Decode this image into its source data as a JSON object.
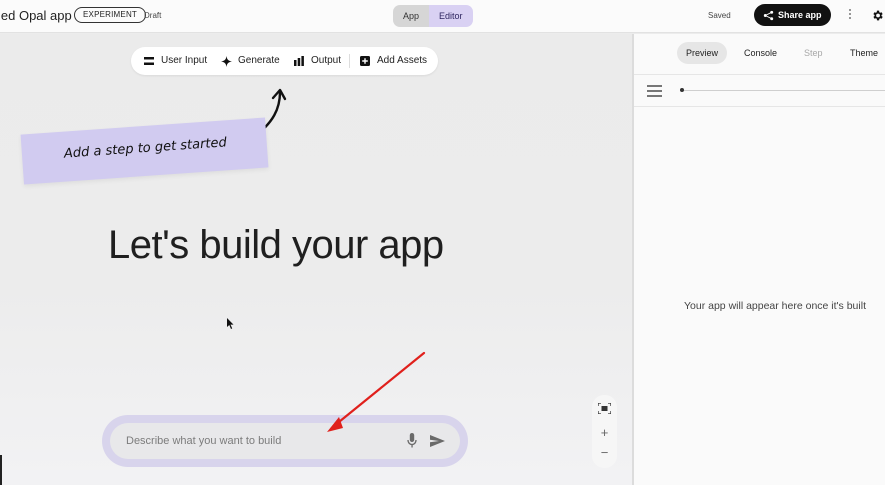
{
  "header": {
    "title": "led Opal app",
    "badge": "EXPERIMENT",
    "status": "Draft",
    "tabs": [
      {
        "label": "App",
        "active": false
      },
      {
        "label": "Editor",
        "active": true
      }
    ],
    "saved_label": "Saved",
    "share_label": "Share app",
    "icons": [
      "share-icon",
      "more-vert-icon",
      "settings-gear-icon"
    ]
  },
  "toolbar": {
    "items": [
      {
        "label": "User Input",
        "icon": "user-input-icon"
      },
      {
        "label": "Generate",
        "icon": "sparkle-icon"
      },
      {
        "label": "Output",
        "icon": "bar-chart-icon"
      },
      {
        "label": "Add Assets",
        "icon": "add-box-icon"
      }
    ]
  },
  "canvas": {
    "sticky_note": "Add a step to get started",
    "hero_title": "Let's build your app",
    "prompt_placeholder": "Describe what you want to build",
    "prompt_value": "",
    "zoom_controls": {
      "fit": "fit-screen-icon",
      "in": "+",
      "out": "−"
    }
  },
  "preview_panel": {
    "tabs": [
      {
        "label": "Preview",
        "state": "active"
      },
      {
        "label": "Console",
        "state": "normal"
      },
      {
        "label": "Step",
        "state": "disabled"
      },
      {
        "label": "Theme",
        "state": "normal"
      }
    ],
    "empty_message": "Your app will appear here once it's built"
  },
  "colors": {
    "accent_purple": "#d9d1f3",
    "sticky_note": "#d1cbf0",
    "share_button": "#111111",
    "annotation_red": "#e0201c"
  }
}
